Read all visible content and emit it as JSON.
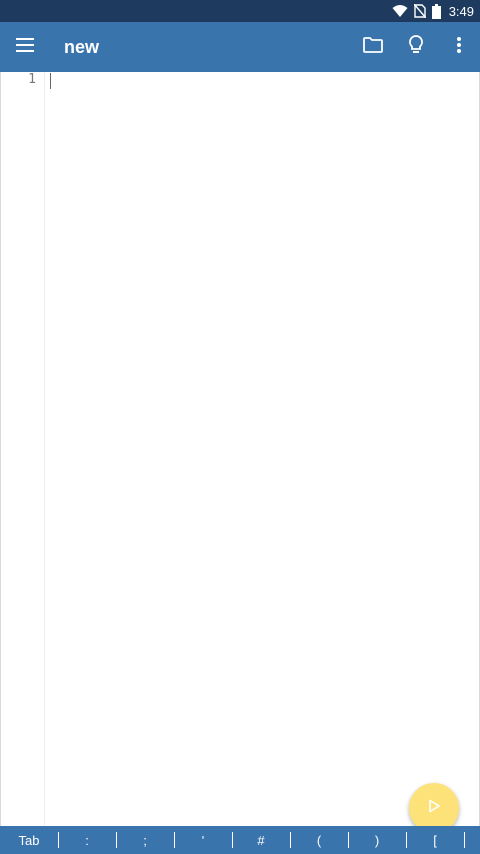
{
  "status_bar": {
    "time": "3:49",
    "icons": [
      "wifi-icon",
      "no-sim-icon",
      "battery-icon"
    ]
  },
  "app_bar": {
    "title": "new",
    "icons": [
      "menu-icon",
      "folder-icon",
      "lightbulb-icon",
      "more-vert-icon"
    ]
  },
  "editor": {
    "line_numbers": [
      "1"
    ],
    "content": ""
  },
  "fab": {
    "icon": "play-icon",
    "color": "#fde27a"
  },
  "key_bar": {
    "keys": [
      "Tab",
      ":",
      ";",
      "'",
      "#",
      "(",
      ")",
      "["
    ]
  },
  "colors": {
    "status_bar": "#1e3a5f",
    "app_bar": "#3a74ad",
    "fab": "#fde27a"
  }
}
